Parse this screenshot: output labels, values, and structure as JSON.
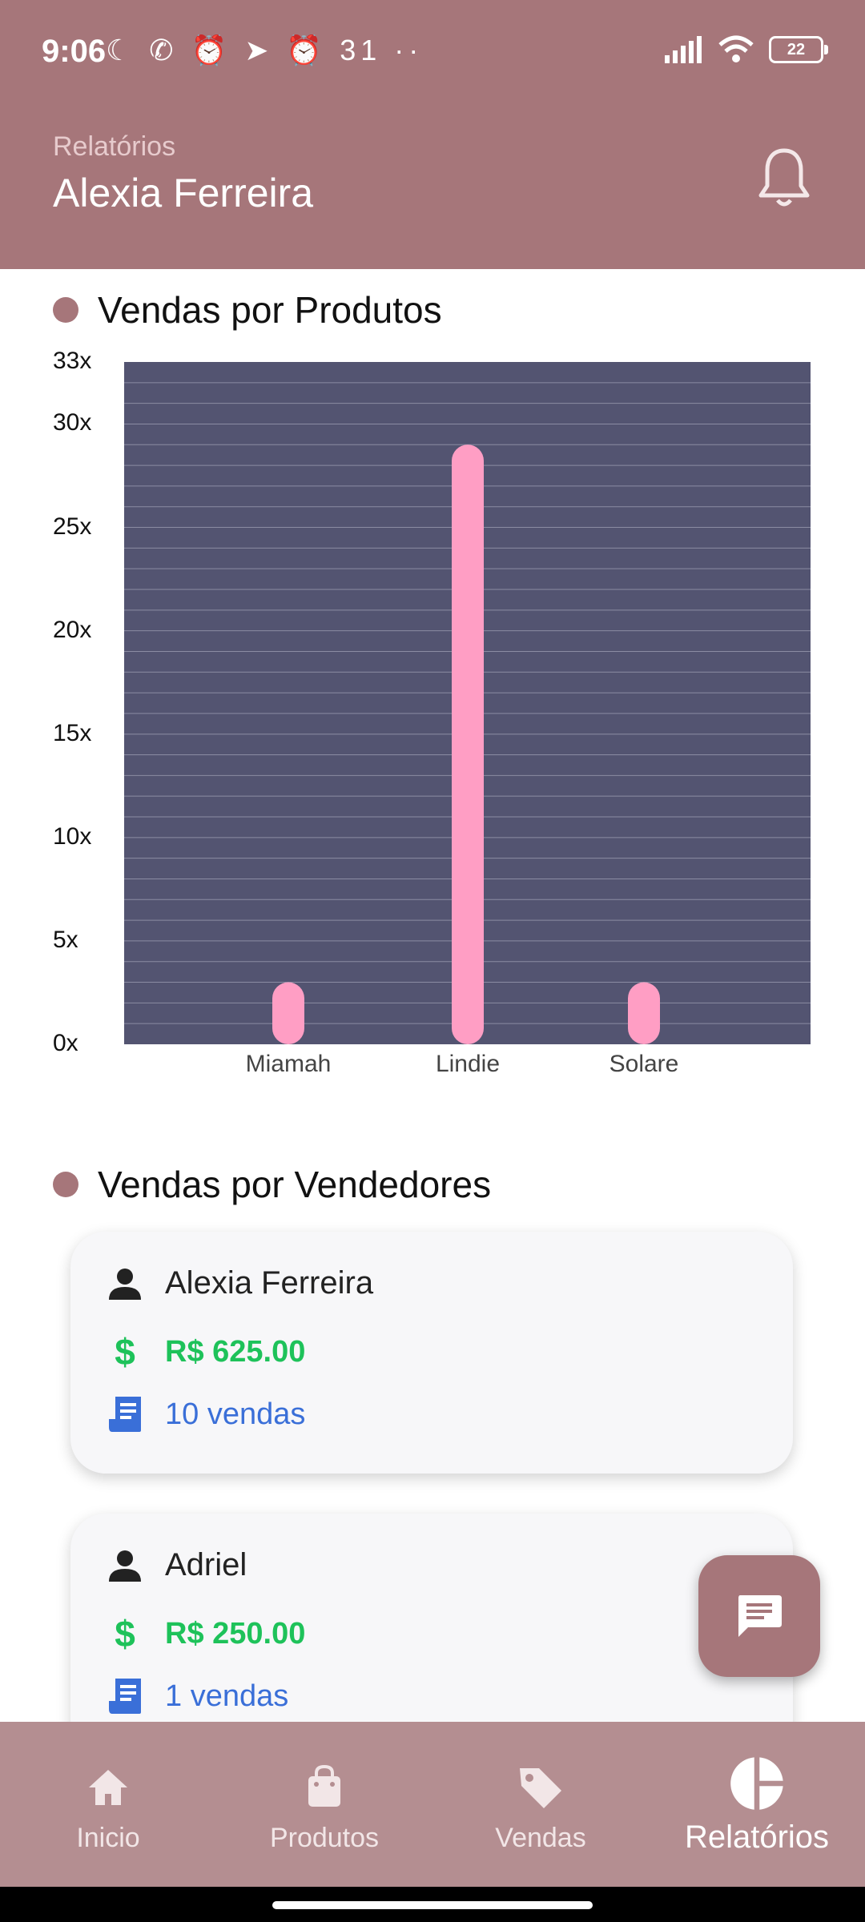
{
  "status": {
    "time": "9:06",
    "left_icons": "☾ ✆ ⏰ ➤ ⏰ 31 ··",
    "battery": "22"
  },
  "header": {
    "subtitle": "Relatórios",
    "title": "Alexia Ferreira",
    "bell_icon": "bell-icon"
  },
  "products_section": {
    "title": "Vendas por Produtos"
  },
  "chart_data": {
    "type": "bar",
    "categories": [
      "Miamah",
      "Lindie",
      "Solare"
    ],
    "values": [
      3,
      29,
      3
    ],
    "ylim": [
      0,
      33
    ],
    "y_ticks": [
      "0x",
      "5x",
      "10x",
      "15x",
      "20x",
      "25x",
      "30x",
      "33x"
    ],
    "y_tick_values": [
      0,
      5,
      10,
      15,
      20,
      25,
      30,
      33
    ],
    "grid": true,
    "colors": {
      "bar": "#ff9ec4",
      "background": "#535471",
      "grid": "#8b8ca3"
    }
  },
  "sellers_section": {
    "title": "Vendas por Vendedores"
  },
  "sellers": [
    {
      "name": "Alexia Ferreira",
      "amount": "R$ 625.00",
      "sales": "10 vendas"
    },
    {
      "name": "Adriel",
      "amount": "R$ 250.00",
      "sales": "1 vendas"
    }
  ],
  "nav": {
    "items": [
      {
        "label": "Inicio",
        "icon": "home-icon"
      },
      {
        "label": "Produtos",
        "icon": "shopping-bag-icon"
      },
      {
        "label": "Vendas",
        "icon": "tag-icon"
      },
      {
        "label": "Relatórios",
        "icon": "pie-chart-icon"
      }
    ],
    "active": "Relatórios"
  },
  "colors": {
    "primary": "#a6767a",
    "green": "#1ec25a",
    "blue": "#3a6fd8"
  }
}
